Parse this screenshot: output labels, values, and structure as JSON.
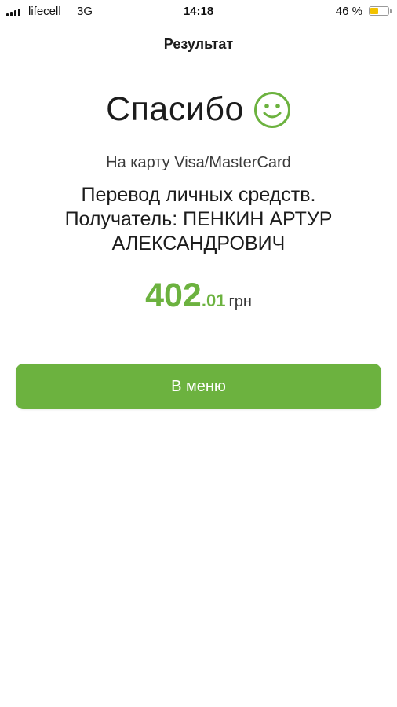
{
  "status_bar": {
    "carrier": "lifecell",
    "network": "3G",
    "time": "14:18",
    "battery_percent": "46 %",
    "battery_level": 0.46,
    "signal_icon": "signal-bars-icon",
    "battery_icon": "battery-icon"
  },
  "header": {
    "title": "Результат"
  },
  "result": {
    "thanks": "Спасибо",
    "thanks_icon": "smiley-icon",
    "card_line": "На карту Visa/MasterCard",
    "purpose_lines": [
      "Перевод личных средств.",
      "Получатель: ПЕНКИН АРТУР",
      "АЛЕКСАНДРОВИЧ"
    ],
    "amount_major": "402",
    "amount_minor": ".01",
    "currency": "грн"
  },
  "actions": {
    "menu_label": "В меню"
  },
  "colors": {
    "accent": "#6cb23f",
    "text": "#1c1c1c",
    "battery": "#f2c200"
  }
}
